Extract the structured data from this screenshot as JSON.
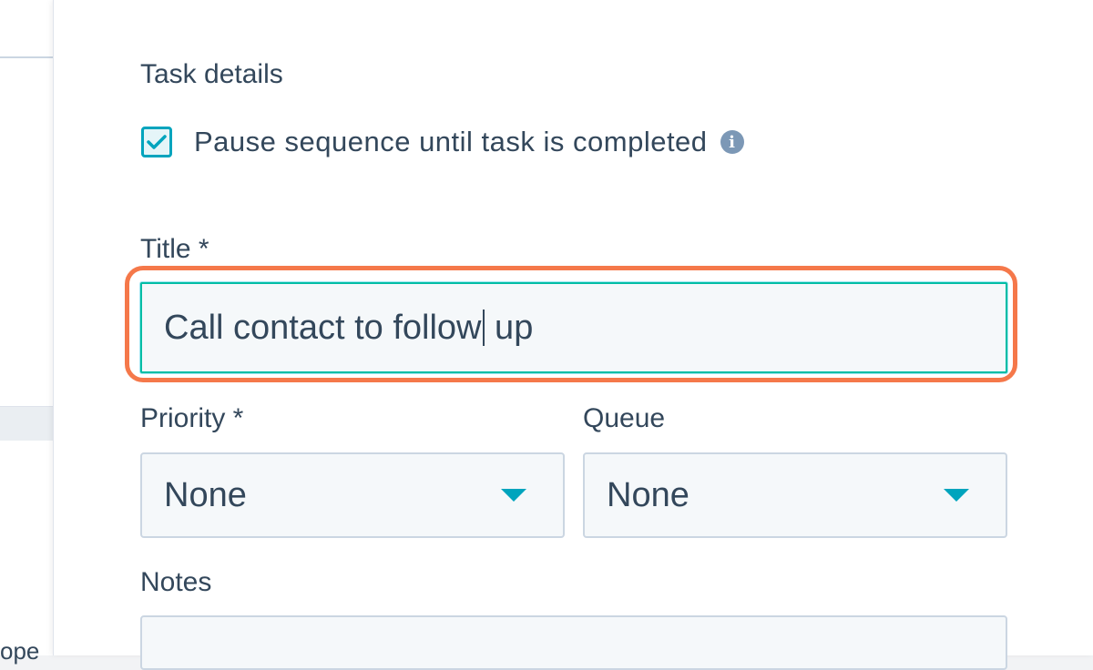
{
  "background": {
    "fragment_text": "ope"
  },
  "task_details": {
    "section_title": "Task details",
    "pause_checkbox": {
      "label": "Pause sequence until task is completed",
      "checked": true,
      "info_icon": "info-icon"
    },
    "title_field": {
      "label": "Title *",
      "value_before_cursor": "Call contact to follow",
      "value_after_cursor": " up"
    },
    "priority_field": {
      "label": "Priority *",
      "selected": "None"
    },
    "queue_field": {
      "label": "Queue",
      "selected": "None"
    },
    "notes_field": {
      "label": "Notes",
      "value": ""
    }
  },
  "colors": {
    "accent": "#00a4bd",
    "highlight": "#f5784a",
    "text": "#33475b",
    "input_bg": "#f5f8fa",
    "border": "#cbd6e2"
  }
}
